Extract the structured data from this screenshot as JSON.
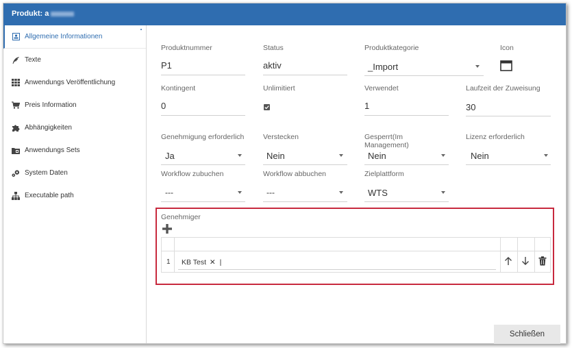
{
  "window": {
    "title": "Produkt: a",
    "close_label": "Schließen"
  },
  "sidebar": {
    "items": [
      {
        "label": "Allgemeine Informationen",
        "icon": "info-card-icon",
        "active": true
      },
      {
        "label": "Texte",
        "icon": "feather-icon"
      },
      {
        "label": "Anwendungs Veröffentlichung",
        "icon": "grid-icon"
      },
      {
        "label": "Preis Information",
        "icon": "cart-icon"
      },
      {
        "label": "Abhängigkeiten",
        "icon": "puzzle-icon"
      },
      {
        "label": "Anwendungs Sets",
        "icon": "folder-icon"
      },
      {
        "label": "System Daten",
        "icon": "gears-icon"
      },
      {
        "label": "Executable path",
        "icon": "hierarchy-icon"
      }
    ]
  },
  "form": {
    "produktnummer": {
      "label": "Produktnummer",
      "value": "P1"
    },
    "status": {
      "label": "Status",
      "value": "aktiv"
    },
    "produktkategorie": {
      "label": "Produktkategorie",
      "value": "_Import"
    },
    "icon": {
      "label": "Icon"
    },
    "kontingent": {
      "label": "Kontingent",
      "value": "0"
    },
    "unlimitiert": {
      "label": "Unlimitiert",
      "checked": true
    },
    "verwendet": {
      "label": "Verwendet",
      "value": "1"
    },
    "laufzeit": {
      "label": "Laufzeit der Zuweisung",
      "value": "30"
    },
    "genehmigung": {
      "label": "Genehmigung erforderlich",
      "value": "Ja"
    },
    "verstecken": {
      "label": "Verstecken",
      "value": "Nein"
    },
    "gesperrt": {
      "label": "Gesperrt(Im Management)",
      "value": "Nein"
    },
    "lizenz": {
      "label": "Lizenz erforderlich",
      "value": "Nein"
    },
    "workflow_zubuchen": {
      "label": "Workflow zubuchen",
      "value": "---"
    },
    "workflow_abbuchen": {
      "label": "Workflow abbuchen",
      "value": "---"
    },
    "zielplattform": {
      "label": "Zielplattform",
      "value": "WTS"
    }
  },
  "approvers": {
    "label": "Genehmiger",
    "rows": [
      {
        "index": "1",
        "tag": "KB Test"
      }
    ]
  }
}
